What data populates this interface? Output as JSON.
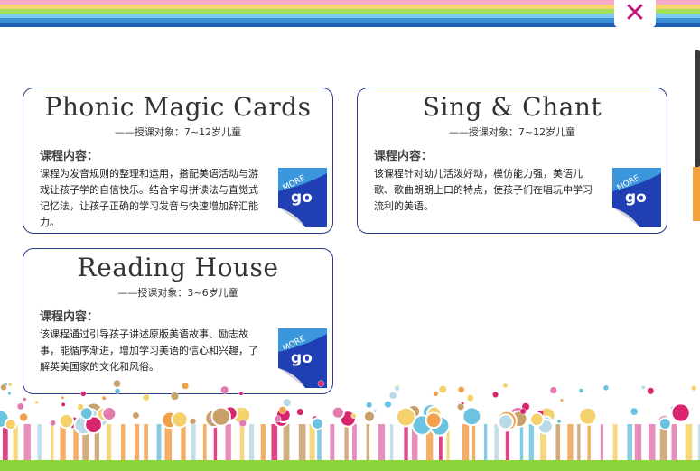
{
  "header": {
    "close_label": "✕",
    "colors": {
      "stripes": [
        "#f4a9c8",
        "#f7d56a",
        "#a5df5c",
        "#7cc8ee",
        "#3a8fd6"
      ],
      "close": "#c2187a"
    }
  },
  "cards": [
    {
      "title": "Phonic Magic Cards",
      "subtitle": "——授课对象：7~12岁儿童",
      "heading": "课程内容：",
      "body": "课程为发音规则的整理和运用，搭配美语活动与游戏让孩子学的自信快乐。结合字母拼读法与直觉式记忆法，让孩子正确的学习发音与快速增加辞汇能力。",
      "more_label": "MORE",
      "go_label": "go"
    },
    {
      "title": "Sing & Chant",
      "subtitle": "——授课对象：7~12岁儿童",
      "heading": "课程内容：",
      "body": "该课程针对幼儿活泼好动，模仿能力强，美语儿歌、歌曲朗朗上口的特点，使孩子们在唱玩中学习流利的美语。",
      "more_label": "MORE",
      "go_label": "go"
    },
    {
      "title": "Reading House",
      "subtitle": "——授课对象：3~6岁儿童",
      "heading": "课程内容：",
      "body": "该课程通过引导孩子讲述原版美语故事、励志故事，能循序渐进，增加学习美语的信心和兴趣，了解英美国家的文化和风俗。",
      "more_label": "MORE",
      "go_label": "go"
    }
  ],
  "theme": {
    "card_border": "#2b3a8e",
    "badge_blue": "#1f3fb3",
    "badge_ribbon": "#3ea0e0",
    "decor_colors": [
      "#d9246e",
      "#f3a04a",
      "#6cc3e0",
      "#f4d16a",
      "#e27bb0",
      "#b7d9e8",
      "#c8a06a"
    ]
  }
}
